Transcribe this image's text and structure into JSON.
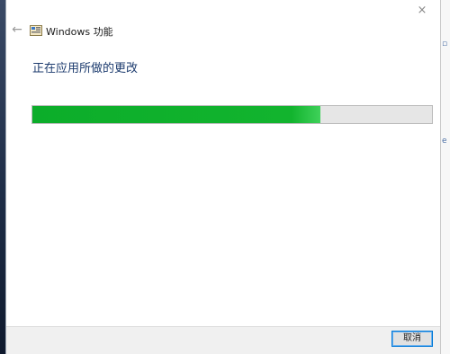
{
  "window": {
    "title": "Windows 功能",
    "back_icon": "arrow-left-icon",
    "app_icon": "windows-features-icon",
    "close_icon": "close-icon",
    "close_glyph": "×",
    "back_glyph": "←"
  },
  "main": {
    "status_text": "正在应用所做的更改",
    "progress_fraction": 0.72,
    "progress_color": "#12b42e"
  },
  "footer": {
    "cancel_label": "取消"
  }
}
